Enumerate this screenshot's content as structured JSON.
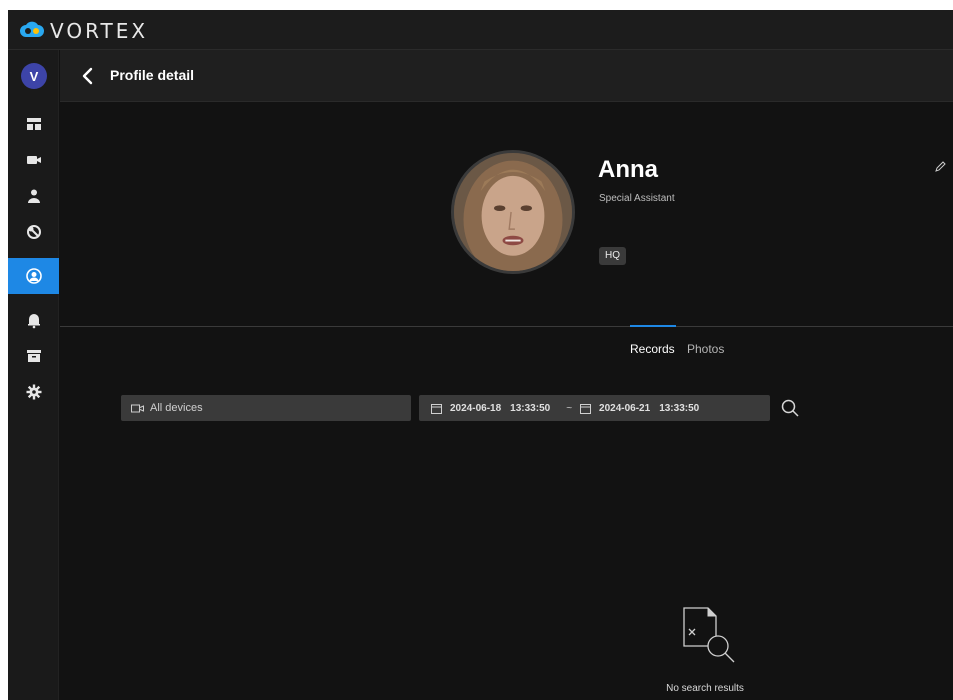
{
  "app": {
    "brand": "VORTEX",
    "accent_color": "#1e88e5",
    "logo_icon": "cloud-logo-icon"
  },
  "sidebar": {
    "avatar_initial": "V",
    "items": [
      {
        "icon": "dashboard-icon"
      },
      {
        "icon": "camera-icon"
      },
      {
        "icon": "person-icon"
      },
      {
        "icon": "face-recognition-icon"
      },
      {
        "icon": "profile-icon",
        "active": true
      },
      {
        "icon": "bell-icon"
      },
      {
        "icon": "archive-icon"
      },
      {
        "icon": "gear-icon"
      }
    ]
  },
  "header": {
    "title": "Profile detail"
  },
  "profile": {
    "name": "Anna",
    "role": "Special Assistant",
    "tag": "HQ"
  },
  "tabs": {
    "records": "Records",
    "photos": "Photos",
    "active": "Records"
  },
  "filters": {
    "device": "All devices",
    "start_date": "2024-06-18",
    "start_time": "13:33:50",
    "separator": "~",
    "end_date": "2024-06-21",
    "end_time": "13:33:50"
  },
  "results": {
    "empty_text": "No search results"
  }
}
